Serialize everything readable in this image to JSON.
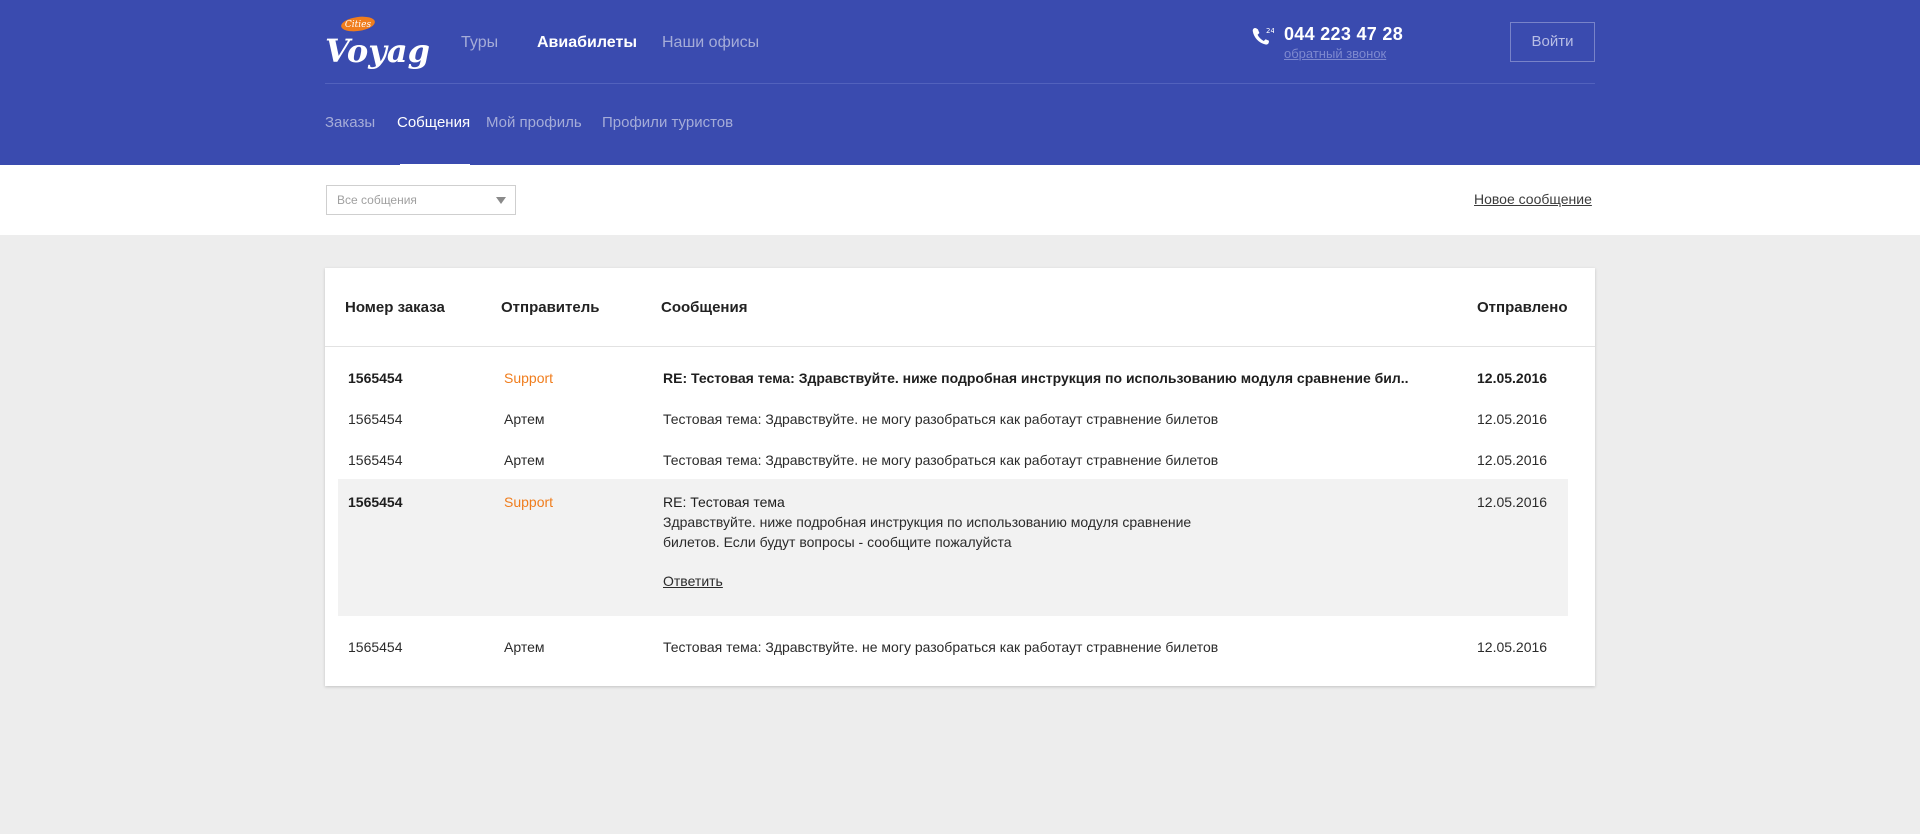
{
  "brand": {
    "logo_badge": "Cities",
    "logo_text": "Voyage",
    "colors": {
      "header": "#3a4baf",
      "accent_support": "#f07d1d",
      "expanded_row": "#f2f2f2"
    }
  },
  "main_nav": {
    "items": [
      {
        "label": "Туры",
        "active": false
      },
      {
        "label": "Авиабилеты",
        "active": true
      },
      {
        "label": "Наши офисы",
        "active": false
      }
    ]
  },
  "phone": {
    "icon": "phone-24-icon",
    "badge": "24",
    "number": "044 223 47 28",
    "callback_label": "обратный звонок"
  },
  "login_label": "Войти",
  "sub_nav": {
    "items": [
      {
        "label": "Заказы",
        "active": false
      },
      {
        "label": "Собщения",
        "active": true
      },
      {
        "label": "Мой профиль",
        "active": false
      },
      {
        "label": "Профили туристов",
        "active": false
      }
    ]
  },
  "filter": {
    "selected": "Все собщения"
  },
  "new_message_label": "Новое сообщение",
  "table": {
    "headers": [
      "Номер заказа",
      "Отправитель",
      "Сообщения",
      "Отправлено"
    ],
    "rows": [
      {
        "order": "1565454",
        "sender": "Support",
        "message": "RE: Тестовая тема: Здравствуйте. ниже подробная инструкция по использованию модуля сравнение бил..",
        "date": "12.05.2016",
        "unread": true
      },
      {
        "order": "1565454",
        "sender": "Артем",
        "message": "Тестовая тема: Здравствуйте. не могу разобраться как работаут стравнение билетов",
        "date": "12.05.2016",
        "unread": false
      },
      {
        "order": "1565454",
        "sender": "Артем",
        "message": "Тестовая тема: Здравствуйте. не могу разобраться как работаут стравнение билетов",
        "date": "12.05.2016",
        "unread": false
      },
      {
        "order": "1565454",
        "sender": "Support",
        "subject": "RE: Тестовая тема",
        "body_line1": "Здравствуйте. ниже подробная инструкция по использованию модуля сравнение",
        "body_line2": "билетов. Если будут вопросы - сообщите пожалуйста",
        "reply_label": "Ответить",
        "date": "12.05.2016",
        "expanded": true
      },
      {
        "order": "1565454",
        "sender": "Артем",
        "message": "Тестовая тема: Здравствуйте. не могу разобраться как работаут стравнение билетов",
        "date": "12.05.2016",
        "unread": false
      }
    ]
  }
}
